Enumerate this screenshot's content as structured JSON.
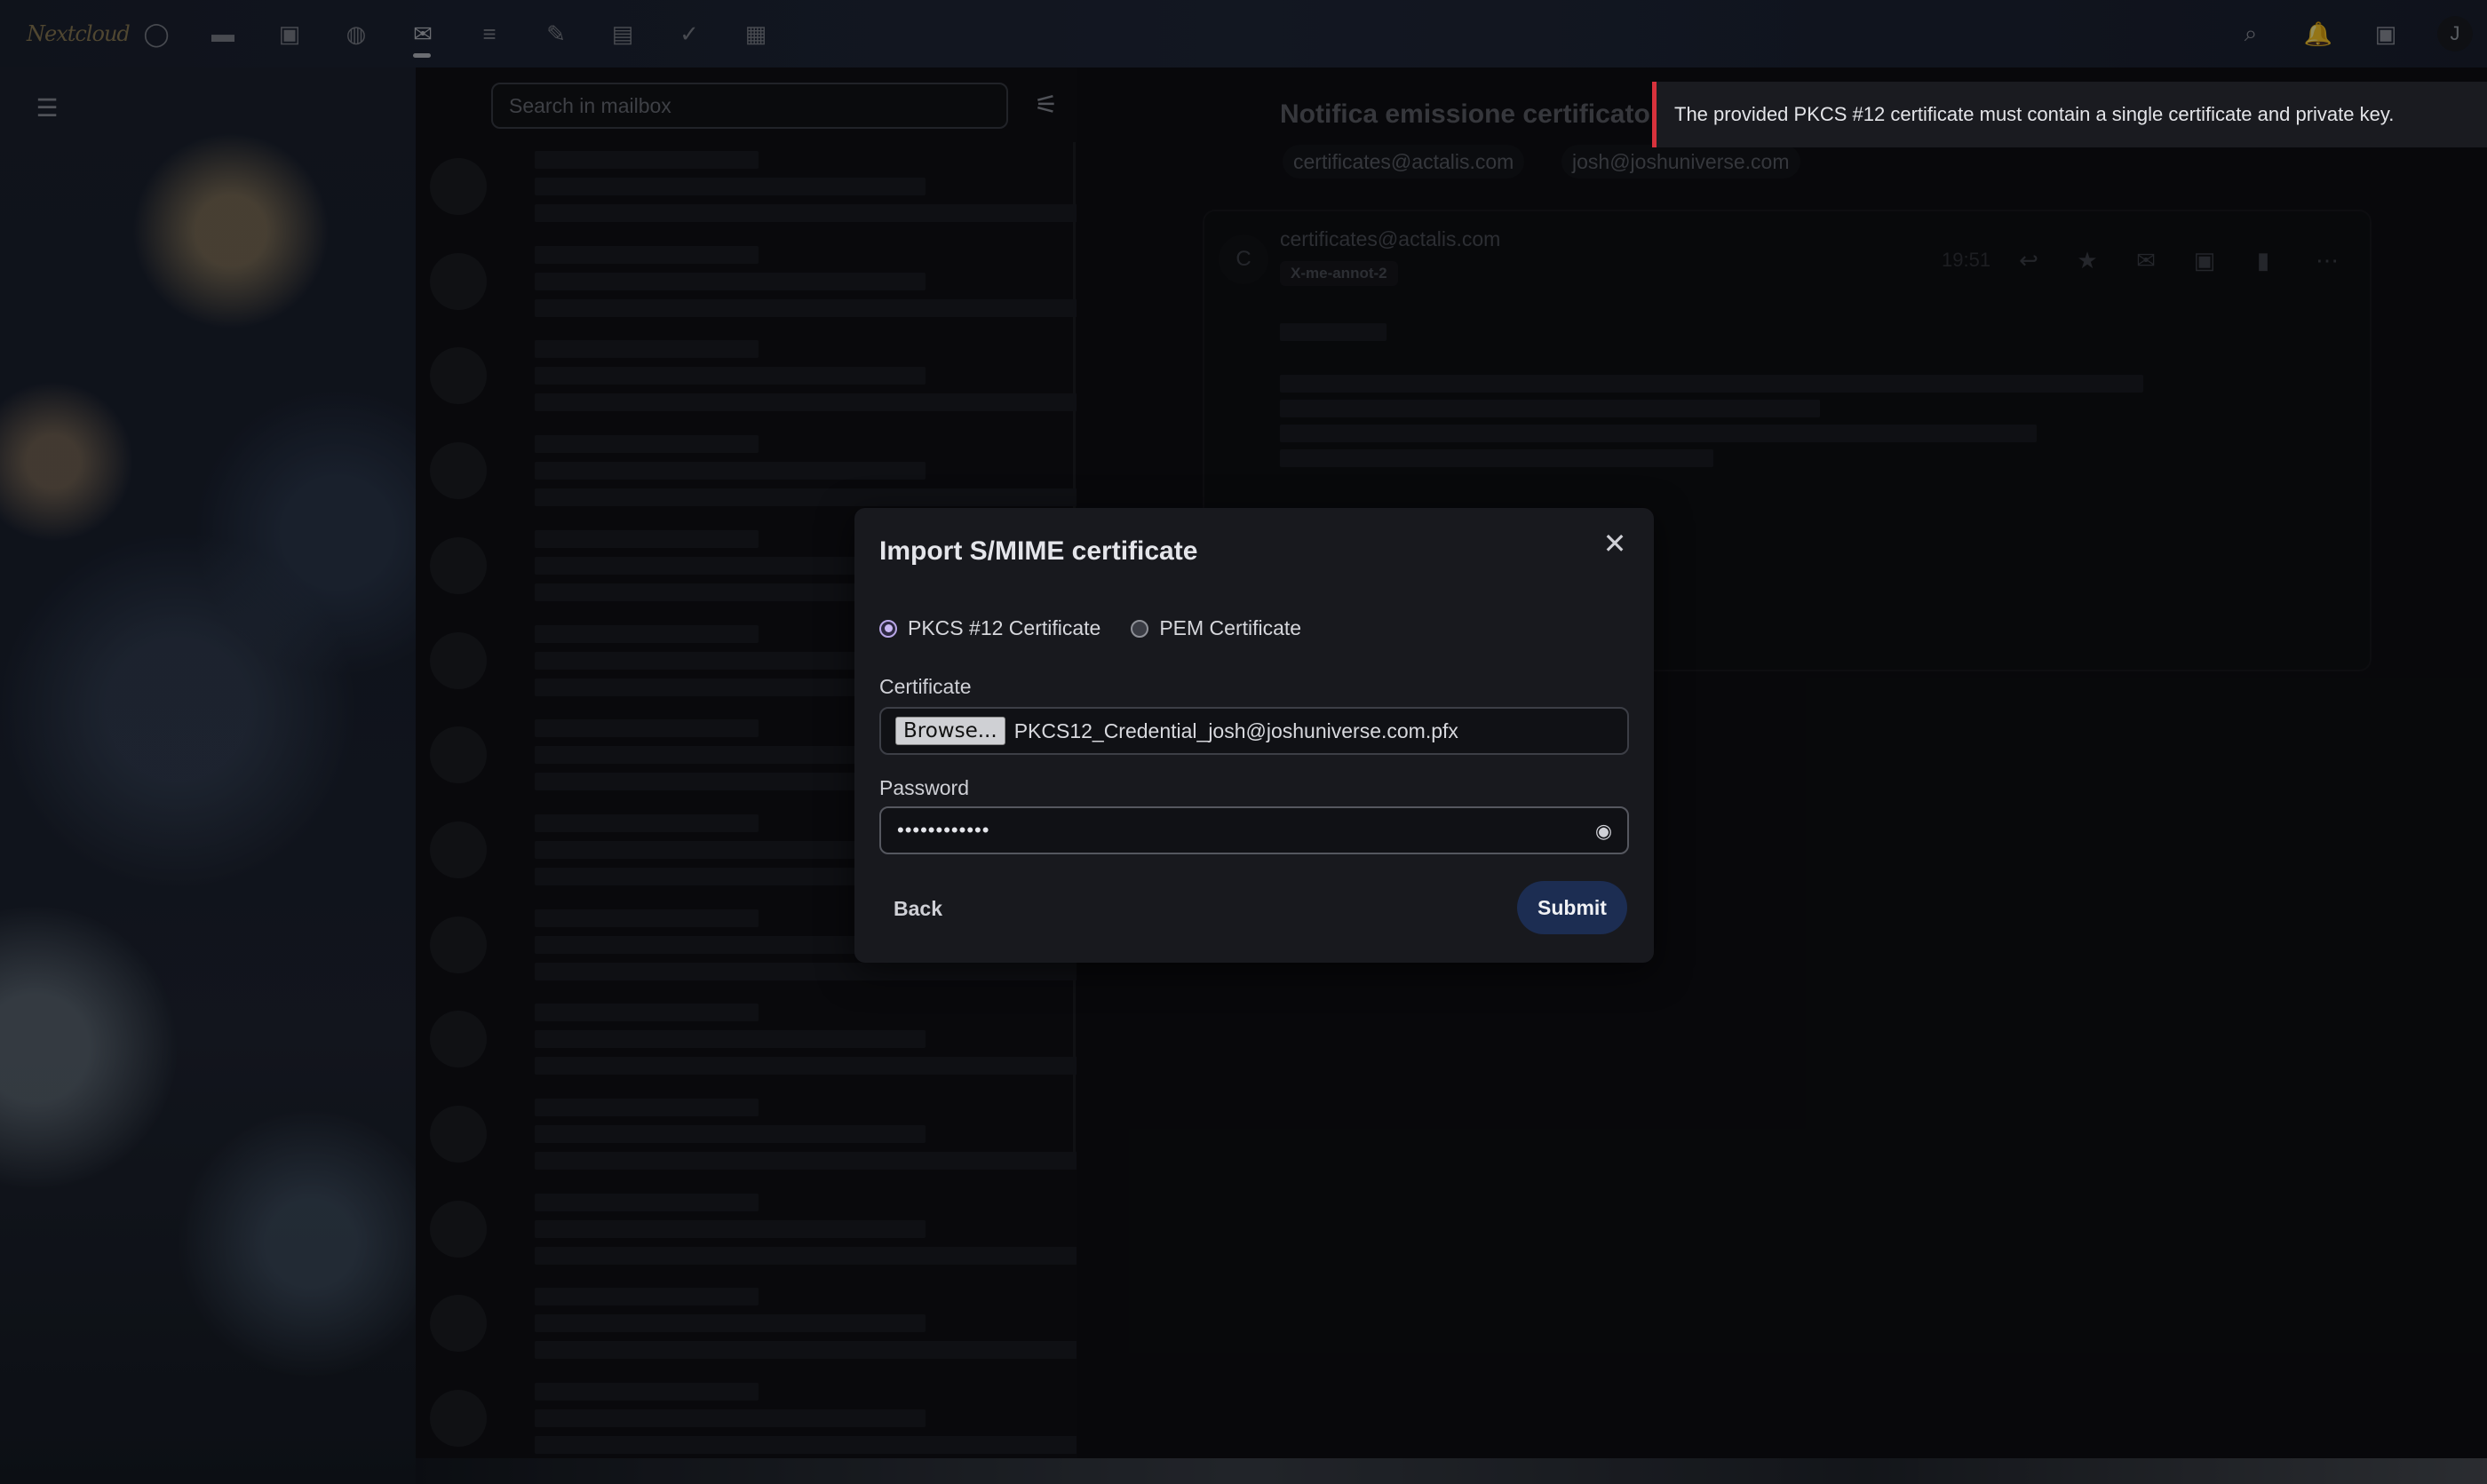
{
  "topbar": {
    "logo": "Nextcloud",
    "apps": [
      {
        "name": "dashboard-icon",
        "glyph": "◯"
      },
      {
        "name": "files-icon",
        "glyph": "▬"
      },
      {
        "name": "photos-icon",
        "glyph": "▣"
      },
      {
        "name": "talk-icon",
        "glyph": "◍"
      },
      {
        "name": "mail-icon",
        "glyph": "✉"
      },
      {
        "name": "notes-icon",
        "glyph": "≡"
      },
      {
        "name": "pencil-icon",
        "glyph": "✎"
      },
      {
        "name": "deck-icon",
        "glyph": "▤"
      },
      {
        "name": "tasks-icon",
        "glyph": "✓"
      },
      {
        "name": "tables-icon",
        "glyph": "▦"
      }
    ],
    "right": [
      {
        "name": "search-icon",
        "glyph": "⌕"
      },
      {
        "name": "notifications-icon",
        "glyph": "🔔"
      },
      {
        "name": "contacts-icon",
        "glyph": "▣"
      }
    ],
    "avatar_letter": "J"
  },
  "mailbox": {
    "search_placeholder": "Search in mailbox"
  },
  "message": {
    "subject": "Notifica emissione certificato S",
    "recipients": [
      "certificates@actalis.com",
      "josh@joshuniverse.com"
    ],
    "from": "certificates@actalis.com",
    "tag": "X-me-annot-2",
    "time": "19:51"
  },
  "toast": {
    "text": "The provided PKCS #12 certificate must contain a single certificate and private key."
  },
  "modal": {
    "title": "Import S/MIME certificate",
    "options": [
      {
        "label": "PKCS #12 Certificate",
        "checked": true
      },
      {
        "label": "PEM Certificate",
        "checked": false
      }
    ],
    "certificate_label": "Certificate",
    "browse_label": "Browse...",
    "file_name": "PKCS12_Credential_josh@joshuniverse.com.pfx",
    "password_label": "Password",
    "password_value": "••••••••••••",
    "back_label": "Back",
    "submit_label": "Submit"
  }
}
